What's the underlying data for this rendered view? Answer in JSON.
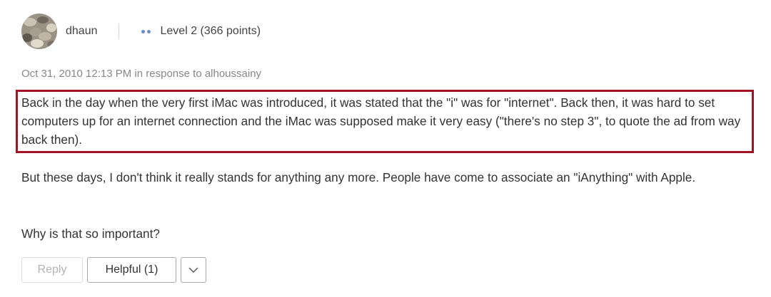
{
  "post": {
    "author": {
      "username": "dhaun",
      "level": "Level 2",
      "points": "(366 points)"
    },
    "meta": "Oct 31, 2010 12:13 PM in response to alhoussainy",
    "paragraphs": [
      "Back in the day when the very first iMac was introduced, it was stated that the \"i\" was for \"internet\". Back then, it was hard to set computers up for an internet connection and the iMac was supposed make it very easy (\"there's no step 3\", to quote the ad from way back then).",
      "But these days, I don't think it really stands for anything any more. People have come to associate an \"iAnything\" with Apple.",
      "Why is that so important?"
    ],
    "actions": {
      "reply_label": "Reply",
      "helpful_label": "Helpful (1)",
      "more_icon": "chevron-down-icon"
    }
  },
  "colors": {
    "highlight_border": "#a11423",
    "level_dots": "#6b8fc9"
  }
}
